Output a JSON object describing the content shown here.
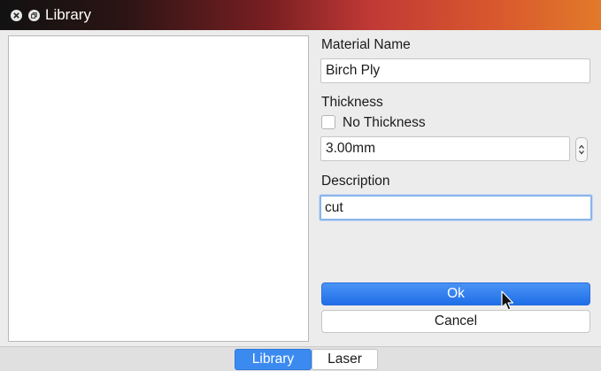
{
  "window": {
    "title": "Library"
  },
  "form": {
    "material_name": {
      "label": "Material Name",
      "value": "Birch Ply"
    },
    "thickness": {
      "label": "Thickness",
      "no_thickness_label": "No Thickness",
      "no_thickness_checked": false,
      "value": "3.00mm"
    },
    "description": {
      "label": "Description",
      "value": "cut"
    }
  },
  "buttons": {
    "ok_label": "Ok",
    "cancel_label": "Cancel"
  },
  "tabs": [
    {
      "label": "Library",
      "selected": true
    },
    {
      "label": "Laser",
      "selected": false
    }
  ],
  "icons": {
    "close": "close-icon",
    "restore": "restore-icon",
    "spinner": "up-down-arrows-icon",
    "cursor": "mouse-pointer-icon"
  },
  "colors": {
    "accent": "#2f7ff0",
    "focus_ring": "#8ab4e8"
  }
}
